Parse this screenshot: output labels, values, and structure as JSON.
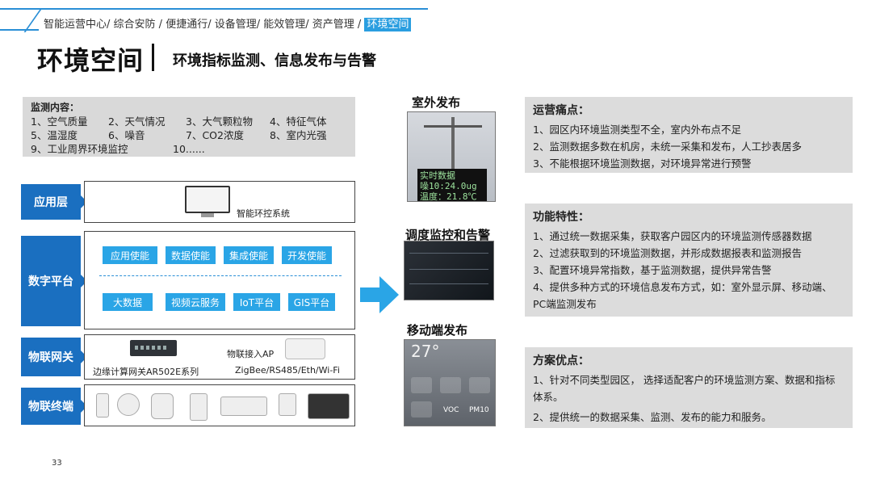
{
  "breadcrumb": {
    "items": [
      "智能运营中心/",
      "综合安防 /",
      "便捷通行/",
      "设备管理/",
      "能效管理/",
      "资产管理 /"
    ],
    "active": "环境空间"
  },
  "title": "环境空间",
  "subtitle": "环境指标监测、信息发布与告警",
  "monitor": {
    "heading": "监测内容：",
    "rows": [
      [
        "1、空气质量",
        "2、天气情况",
        "3、大气颗粒物",
        "4、特征气体"
      ],
      [
        "5、温湿度",
        "6、噪音",
        "7、CO2浓度",
        "8、室内光强"
      ],
      [
        "9、工业周界环境监控",
        "10......"
      ]
    ]
  },
  "layers": {
    "app": {
      "label": "应用层",
      "caption": "智能环控系统"
    },
    "digital": {
      "label": "数字平台",
      "top_buttons": [
        "应用使能",
        "数据使能",
        "集成使能",
        "开发使能"
      ],
      "bottom_buttons": [
        "大数据",
        "视频云服务",
        "IoT平台",
        "GIS平台"
      ]
    },
    "gateway": {
      "label": "物联网关",
      "edge_caption": "边缘计算网关AR502E系列",
      "ap_caption": "物联接入AP",
      "protocol_caption": "ZigBee/RS485/Eth/Wi-Fi"
    },
    "terminal": {
      "label": "物联终端"
    }
  },
  "middle": {
    "outdoor_title": "室外发布",
    "outdoor_screen": [
      "实时数据",
      "噪10:24.0ug",
      "温度：21.8℃"
    ],
    "dispatch_title": "调度监控和告警",
    "mobile_title": "移动端发布",
    "mobile_temp": "27°",
    "mobile_labels": [
      "VOC",
      "PM10"
    ]
  },
  "panels": {
    "pain": {
      "heading": "运营痛点：",
      "items": [
        "1、园区内环境监测类型不全，室内外布点不足",
        "2、监测数据多数在机房，未统一采集和发布，人工抄表居多",
        "3、不能根据环境监测数据，对环境异常进行预警"
      ]
    },
    "features": {
      "heading": "功能特性：",
      "items": [
        "1、通过统一数据采集，获取客户园区内的环境监测传感器数据",
        "2、过滤获取到的环境监测数据，并形成数据报表和监测报告",
        "3、配置环境异常指数，基于监测数据，提供异常告警",
        "4、提供多种方式的环境信息发布方式，如：室外显示屏、移动端、PC端监测发布"
      ]
    },
    "advantages": {
      "heading": "方案优点：",
      "items": [
        "1、针对不同类型园区， 选择适配客户的环境监测方案、数据和指标体系。",
        "2、提供统一的数据采集、监测、发布的能力和服务。"
      ]
    }
  },
  "page_number": "33",
  "colors": {
    "accent": "#1a6fc0",
    "button": "#2aa5e6",
    "panel_bg": "#dcdcdc"
  }
}
